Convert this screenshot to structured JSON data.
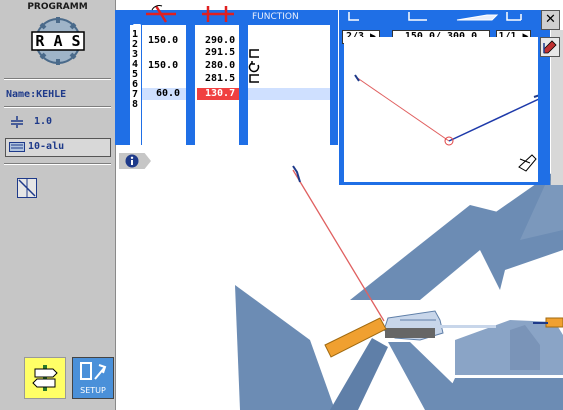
{
  "sidebar": {
    "program_label": "PROGRAMM",
    "logo_text": "R A S",
    "name_label": "Name:KEHLE",
    "thickness_value": "1.0",
    "material_value": "10-alu",
    "setup_label": "SETUP"
  },
  "table": {
    "function_header": "FUNCTION",
    "row_numbers": [
      "1",
      "2",
      "3",
      "4",
      "5",
      "6",
      "7",
      "8"
    ],
    "col_a": [
      "150.0",
      "",
      "150.0",
      "",
      "60.0",
      "",
      "",
      ""
    ],
    "col_b": [
      "290.0",
      "291.5",
      "280.0",
      "281.5",
      "130.7",
      "",
      "",
      ""
    ],
    "selected_row": 5,
    "highlight_value": "130.7"
  },
  "inset": {
    "step_counter": "2/3",
    "length_display": "150.0/ 300.0",
    "page_counter": "1/1"
  },
  "colors": {
    "accent_blue": "#1f6fe6",
    "panel_gray": "#c6c6c6",
    "highlight_red": "#f04040",
    "selected_row_blue": "#cfe0ff",
    "part_orange": "#f0a030",
    "tool_blue": "#6c8cb4"
  },
  "icons": [
    "info-icon",
    "close-icon",
    "pencil-icon",
    "signpost-icon",
    "setup-icon",
    "flip-icon",
    "gauge-icon",
    "material-icon"
  ]
}
